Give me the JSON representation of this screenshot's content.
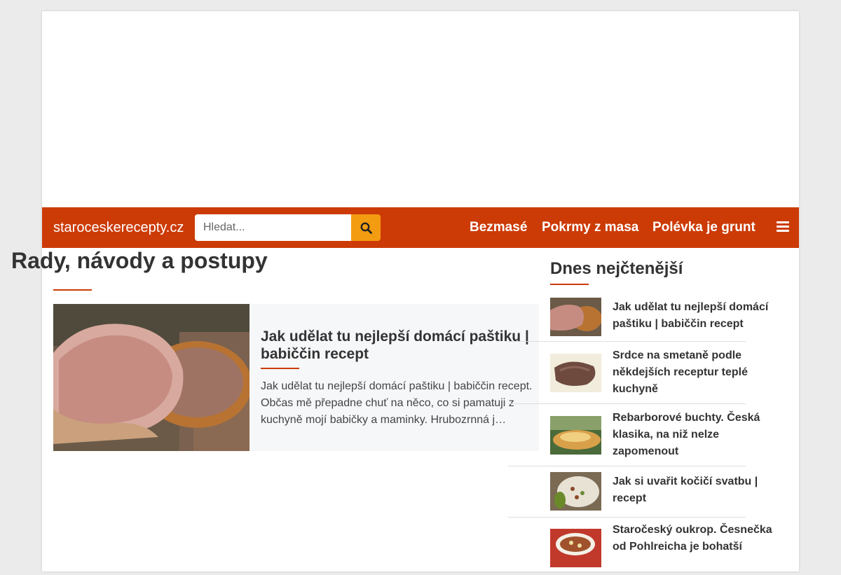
{
  "site": {
    "brand": "staroceskerecepty.cz"
  },
  "search": {
    "placeholder": "Hledat...",
    "icon": "search-icon"
  },
  "nav": {
    "links": [
      "Bezmasé",
      "Pokrmy z masa",
      "Polévka je grunt"
    ],
    "menu_icon": "hamburger-icon"
  },
  "colors": {
    "navbar": "#cc3b06",
    "search_button": "#f39c12",
    "accent": "#cc3b06"
  },
  "main": {
    "title": "Rady, návody a postupy",
    "article": {
      "title": "Jak udělat tu nejlepší domácí paštiku | babiččin recept",
      "excerpt": "Jak udělat tu nejlepší domácí paštiku | babiččin recept. Občas mě přepadne chuť na něco, co si pamatuji z kuchyně mojí babičky a maminky. Hrubozrnná j…"
    }
  },
  "sidebar": {
    "title": "Dnes nejčtenější",
    "items": [
      {
        "title": "Jak udělat tu nejlepší domácí paštiku | babiččin recept"
      },
      {
        "title": "Srdce na smetaně podle někdejších receptur teplé kuchyně"
      },
      {
        "title": "Rebarborové buchty. Česká klasika, na niž nelze zapomenout"
      },
      {
        "title": "Jak si uvařit kočičí svatbu | recept"
      },
      {
        "title": "Staročeský oukrop. Česnečka od Pohlreicha je bohatší"
      }
    ]
  }
}
